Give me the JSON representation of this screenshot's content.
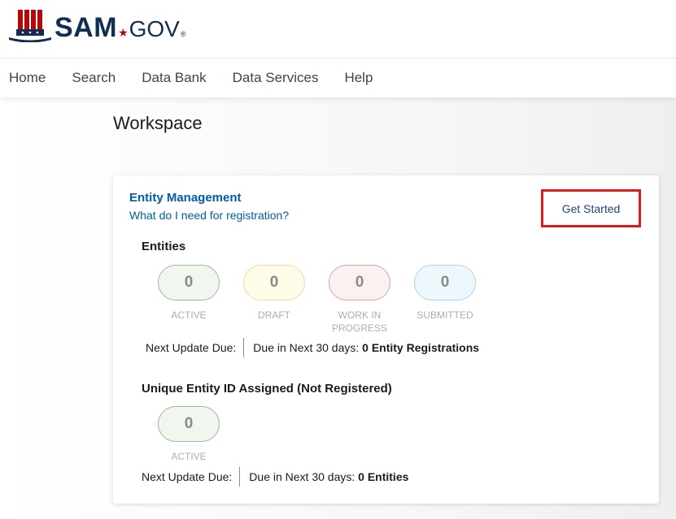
{
  "logo": {
    "sam": "SAM",
    "gov": "GOV",
    "reg": "®",
    "colors": {
      "navy": "#112e51",
      "red": "#b50909"
    }
  },
  "nav": {
    "items": [
      "Home",
      "Search",
      "Data Bank",
      "Data Services",
      "Help"
    ]
  },
  "page": {
    "title": "Workspace"
  },
  "card": {
    "title": "Entity Management",
    "link": "What do I need for registration?",
    "get_started_label": "Get Started",
    "entities": {
      "title": "Entities",
      "stats": [
        {
          "value": "0",
          "label": "ACTIVE"
        },
        {
          "value": "0",
          "label": "DRAFT"
        },
        {
          "value": "0",
          "label": "WORK IN PROGRESS"
        },
        {
          "value": "0",
          "label": "SUBMITTED"
        }
      ],
      "due_label": "Next Update Due:",
      "due_prefix": "Due in Next 30 days:",
      "due_value": "0 Entity Registrations"
    },
    "ueid": {
      "title": "Unique Entity ID Assigned (Not Registered)",
      "stats": [
        {
          "value": "0",
          "label": "ACTIVE"
        }
      ],
      "due_label": "Next Update Due:",
      "due_prefix": "Due in Next 30 days:",
      "due_value": "0 Entities"
    }
  },
  "colors": {
    "link": "#005ea2",
    "highlight_border": "#e01b1b",
    "active_border": "#9fb7a0",
    "active_bg": "#f1f6ef",
    "draft_border": "#f3d9a1",
    "draft_bg": "#fffbe9",
    "wip_border": "#d9a3a3",
    "wip_bg": "#fbf1f1",
    "submitted_border": "#a7d5ea",
    "submitted_bg": "#eef8fc"
  }
}
